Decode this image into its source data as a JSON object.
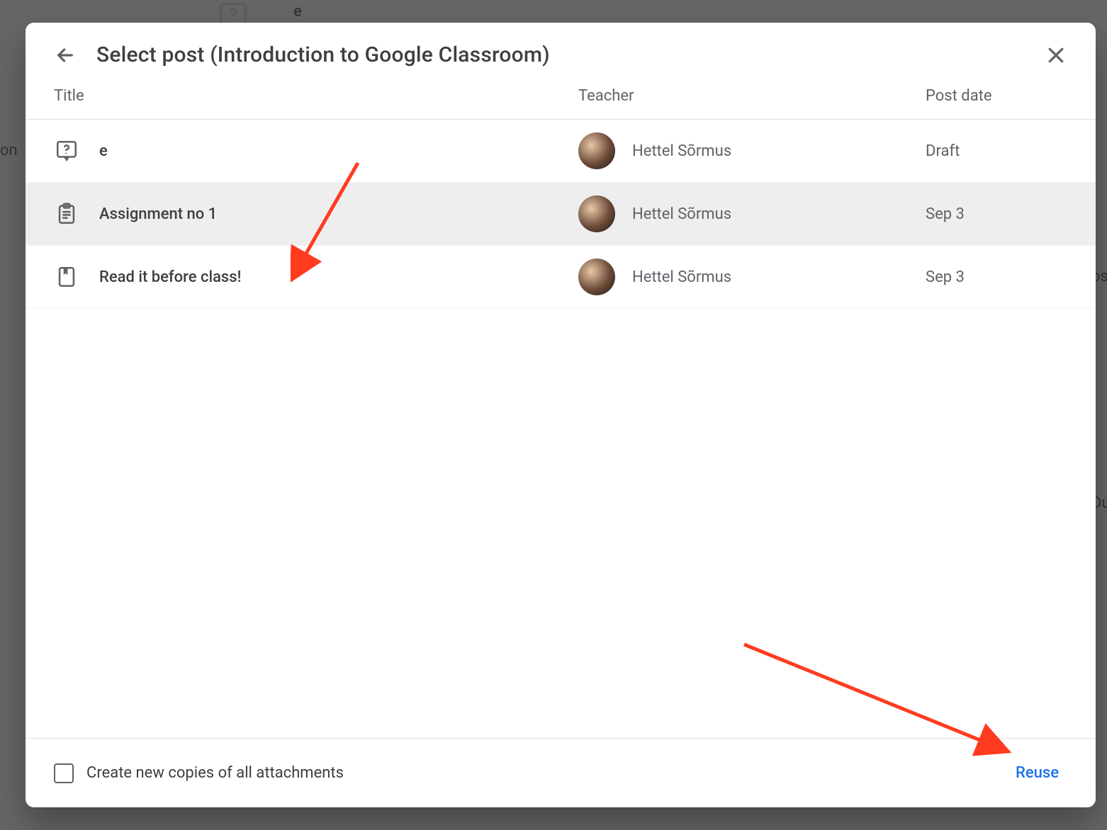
{
  "background": {
    "partial_text_left": "on",
    "partial_text_right_top": "os",
    "partial_text_right_bottom": "Du",
    "top_item_letter": "e"
  },
  "dialog": {
    "title": "Select post (Introduction to Google Classroom)",
    "columns": {
      "title": "Title",
      "teacher": "Teacher",
      "post_date": "Post date"
    },
    "rows": [
      {
        "icon": "question-icon",
        "title": "e",
        "teacher": "Hettel Sõrmus",
        "post_date": "Draft",
        "selected": false
      },
      {
        "icon": "assignment-icon",
        "title": "Assignment no 1",
        "teacher": "Hettel Sõrmus",
        "post_date": "Sep 3",
        "selected": true
      },
      {
        "icon": "material-icon",
        "title": "Read it before class!",
        "teacher": "Hettel Sõrmus",
        "post_date": "Sep 3",
        "selected": false
      }
    ],
    "footer": {
      "checkbox_label": "Create new copies of all attachments",
      "checkbox_checked": false,
      "reuse_label": "Reuse"
    }
  }
}
